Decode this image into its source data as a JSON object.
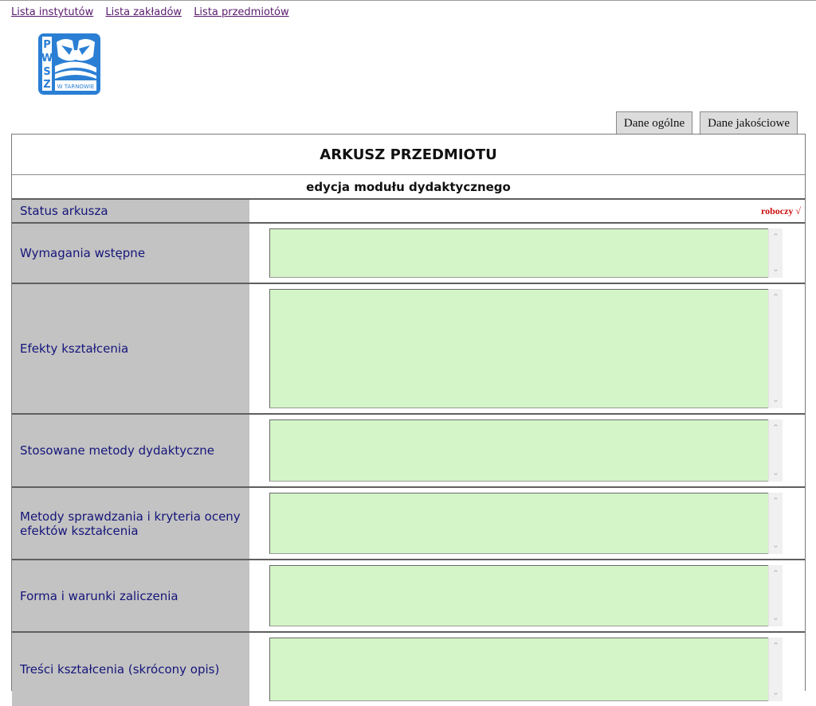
{
  "nav": {
    "links": [
      "Lista instytutów",
      "Lista zakładów",
      "Lista przedmiotów"
    ]
  },
  "logo": {
    "text": "PWSZ",
    "caption": "W TARNOWIE",
    "color": "#2a7fd4"
  },
  "tabs": [
    "Dane ogólne",
    "Dane jakościowe"
  ],
  "sheet": {
    "title": "ARKUSZ PRZEDMIOTU",
    "subtitle": "edycja modułu dydaktycznego",
    "status": {
      "label": "Status arkusza",
      "value": "roboczy √"
    },
    "fields": [
      {
        "label": "Wymagania wstępne",
        "value": ""
      },
      {
        "label": "Efekty kształcenia",
        "value": ""
      },
      {
        "label": "Stosowane metody dydaktyczne",
        "value": ""
      },
      {
        "label": "Metody sprawdzania i kryteria oceny efektów kształcenia",
        "value": ""
      },
      {
        "label": "Forma i warunki zaliczenia",
        "value": ""
      },
      {
        "label": "Treści kształcenia (skrócony opis)",
        "value": ""
      }
    ]
  },
  "colors": {
    "label_bg": "#c3c3c3",
    "label_text": "#15157a",
    "textarea_bg": "#d4f5c8",
    "status_value": "#cc1111",
    "link": "#5a1a6e"
  }
}
